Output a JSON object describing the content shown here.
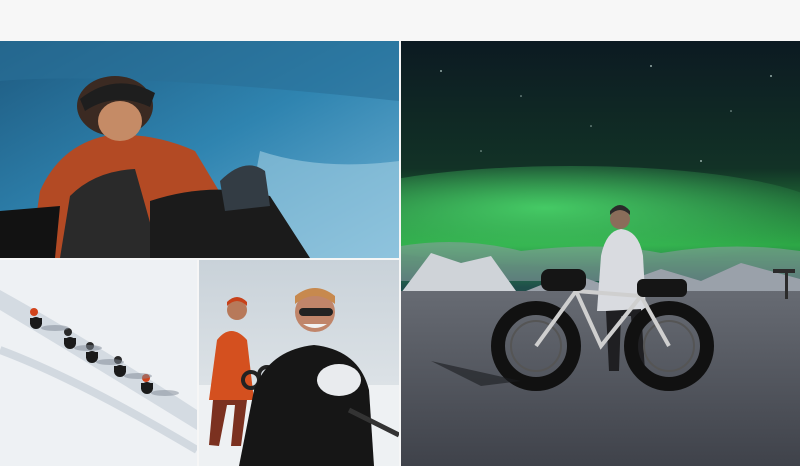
{
  "gallery": {
    "photos": [
      {
        "subject": "rider-in-orange-jacket-with-helmet-over-icy-blue-slope"
      },
      {
        "subject": "green-aurora-over-snowy-mountains-with-fat-tire-bike-and-rider"
      },
      {
        "subject": "line-of-riders-on-fat-bikes-crossing-snowfield"
      },
      {
        "subject": "two-riders-in-snow-one-in-orange-one-smiling-with-goggles"
      }
    ]
  }
}
